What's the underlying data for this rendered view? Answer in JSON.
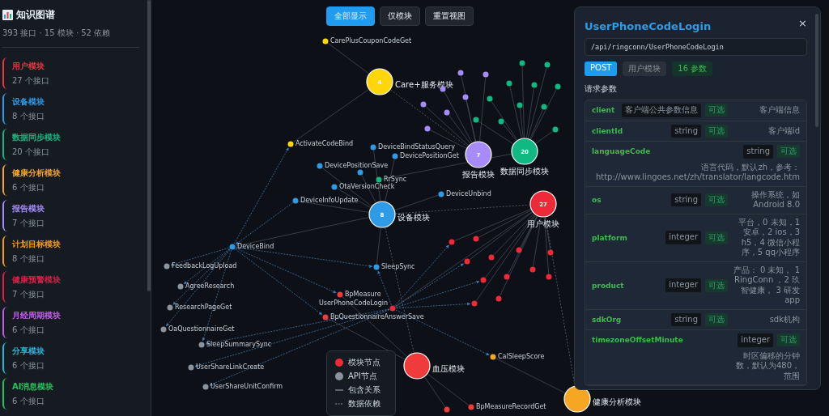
{
  "sidebar": {
    "title": "知识图谱",
    "stats": "393 接口 · 15 模块 · 52 依赖",
    "modules": [
      {
        "name": "用户模块",
        "count": "27 个接口",
        "color": "#ef3340"
      },
      {
        "name": "设备模块",
        "count": "8 个接口",
        "color": "#2f9be6"
      },
      {
        "name": "数据同步模块",
        "count": "20 个接口",
        "color": "#10b981"
      },
      {
        "name": "健康分析模块",
        "count": "6 个接口",
        "color": "#f5a623"
      },
      {
        "name": "报告模块",
        "count": "7 个接口",
        "color": "#a78bfa"
      },
      {
        "name": "计划目标模块",
        "count": "8 个接口",
        "color": "#f59e0b"
      },
      {
        "name": "健康预警模块",
        "count": "7 个接口",
        "color": "#e11d48"
      },
      {
        "name": "月经周期模块",
        "count": "6 个接口",
        "color": "#c15ee8"
      },
      {
        "name": "分享模块",
        "count": "6 个接口",
        "color": "#22b8dc"
      },
      {
        "name": "AI消息模块",
        "count": "6 个接口",
        "color": "#22c55e"
      }
    ]
  },
  "toolbar": [
    {
      "label": "全部显示",
      "selected": true
    },
    {
      "label": "仅模块",
      "selected": false
    },
    {
      "label": "重置视图",
      "selected": false
    }
  ],
  "graph": {
    "modules": [
      {
        "label": "Care+服务模块",
        "count": "4",
        "color": "#ffd60a",
        "apis": [
          {
            "kind": "api",
            "label": "CarePlusCouponCodeGet"
          },
          {
            "kind": "api",
            "label": "ActivateCodeBind"
          }
        ]
      },
      {
        "label": "报告模块",
        "count": "7",
        "color": "#a78bfa",
        "apis": [
          {
            "kind": "api"
          },
          {
            "kind": "api"
          },
          {
            "kind": "api"
          },
          {
            "kind": "api"
          },
          {
            "kind": "api"
          },
          {
            "kind": "api"
          },
          {
            "kind": "api"
          }
        ]
      },
      {
        "label": "数据同步模块",
        "count": "20",
        "color": "#10b981",
        "apis": [
          {
            "kind": "api"
          },
          {
            "kind": "api"
          },
          {
            "kind": "api"
          },
          {
            "kind": "api"
          },
          {
            "kind": "api"
          },
          {
            "kind": "api"
          },
          {
            "kind": "api"
          },
          {
            "kind": "api"
          },
          {
            "kind": "api"
          },
          {
            "kind": "api"
          },
          {
            "kind": "api"
          },
          {
            "kind": "api",
            "label": "RrSync"
          }
        ]
      },
      {
        "label": "用户模块",
        "count": "27",
        "color": "#ef2a38",
        "apis": [
          {
            "kind": "api",
            "label": "UserPhoneCodeLogin"
          },
          {
            "kind": "api"
          },
          {
            "kind": "api"
          },
          {
            "kind": "api"
          },
          {
            "kind": "api"
          },
          {
            "kind": "api"
          },
          {
            "kind": "api"
          },
          {
            "kind": "api"
          },
          {
            "kind": "api"
          },
          {
            "kind": "api"
          },
          {
            "kind": "api"
          },
          {
            "kind": "api"
          },
          {
            "kind": "api"
          }
        ]
      },
      {
        "label": "设备模块",
        "count": "8",
        "color": "#2f9be6",
        "apis": [
          {
            "kind": "api",
            "label": "DeviceBindStatusQuery"
          },
          {
            "kind": "api",
            "label": "DevicePositionSave"
          },
          {
            "kind": "api"
          },
          {
            "kind": "api",
            "label": "DevicePositionGet"
          },
          {
            "kind": "api",
            "label": "OtaVersionCheck"
          },
          {
            "kind": "api",
            "label": "DeviceInfoUpdate"
          },
          {
            "kind": "api",
            "label": "DeviceUnbind"
          },
          {
            "kind": "api",
            "label": "DeviceBind"
          },
          {
            "kind": "api",
            "label": "SleepSync"
          }
        ]
      },
      {
        "label": "血压模块",
        "color": "#ef3b3b",
        "apis": [
          {
            "kind": "api",
            "label": "BpMeasure"
          },
          {
            "kind": "api",
            "label": "BpQuestionnaireAnswerSave"
          },
          {
            "kind": "api"
          },
          {
            "kind": "api",
            "label": "BpMeasureRecordGet"
          }
        ]
      },
      {
        "label": "健康分析模块",
        "color": "#f5a623",
        "apis": [
          {
            "kind": "api",
            "label": "CalSleepScore"
          }
        ]
      }
    ],
    "other_apis": [
      {
        "kind": "api",
        "label": "FeedbackLogUpload"
      },
      {
        "kind": "api",
        "label": "AgreeResearch"
      },
      {
        "kind": "api",
        "label": "ResearchPageGet"
      },
      {
        "kind": "api",
        "label": "OaQuestionnaireGet"
      },
      {
        "kind": "api",
        "label": "SleepSummarySync"
      },
      {
        "kind": "api",
        "label": "UserShareLinkCreate"
      },
      {
        "kind": "api",
        "label": "UserShareUnitConfirm"
      }
    ]
  },
  "legend": [
    {
      "kind": "module-dot",
      "label": "模块节点"
    },
    {
      "kind": "api-dot",
      "label": "API节点"
    },
    {
      "kind": "solid-line",
      "label": "包含关系"
    },
    {
      "kind": "dashed-line",
      "label": "数据依赖"
    }
  ],
  "detail": {
    "title": "UserPhoneCodeLogin",
    "close": "×",
    "path": "/api/ringconn/UserPhoneCodeLogin",
    "tags": [
      {
        "kind": "method",
        "label": "POST"
      },
      {
        "kind": "module",
        "label": "用户模块"
      },
      {
        "kind": "count",
        "label": "16 参数"
      }
    ],
    "section": "请求参数",
    "params": [
      {
        "name": "client",
        "type": "客户端公共参数信息",
        "required": "可选",
        "description": "客户端信息"
      },
      {
        "name": "clientId",
        "type": "string",
        "required": "可选",
        "description": "客户端id"
      },
      {
        "name": "languageCode",
        "type": "string",
        "required": "可选",
        "description": "语言代码，默认zh，参考：http://www.lingoes.net/zh/translator/langcode.htm"
      },
      {
        "name": "os",
        "type": "string",
        "required": "可选",
        "description": "操作系统，如Android 8.0"
      },
      {
        "name": "platform",
        "type": "integer",
        "required": "可选",
        "description": "平台，0 未知，1 安卓，2 ios，3 h5，4 微信小程序，5 qq小程序"
      },
      {
        "name": "product",
        "type": "integer",
        "required": "可选",
        "description": "产品： 0 未知， 1 RingConn ，2 玖智健康， 3 研发app"
      },
      {
        "name": "sdkOrg",
        "type": "string",
        "required": "可选",
        "description": "sdk机构"
      },
      {
        "name": "timezoneOffsetMinute",
        "type": "integer",
        "required": "可选",
        "description": "时区偏移的分钟数，默认为480，范围"
      }
    ]
  }
}
